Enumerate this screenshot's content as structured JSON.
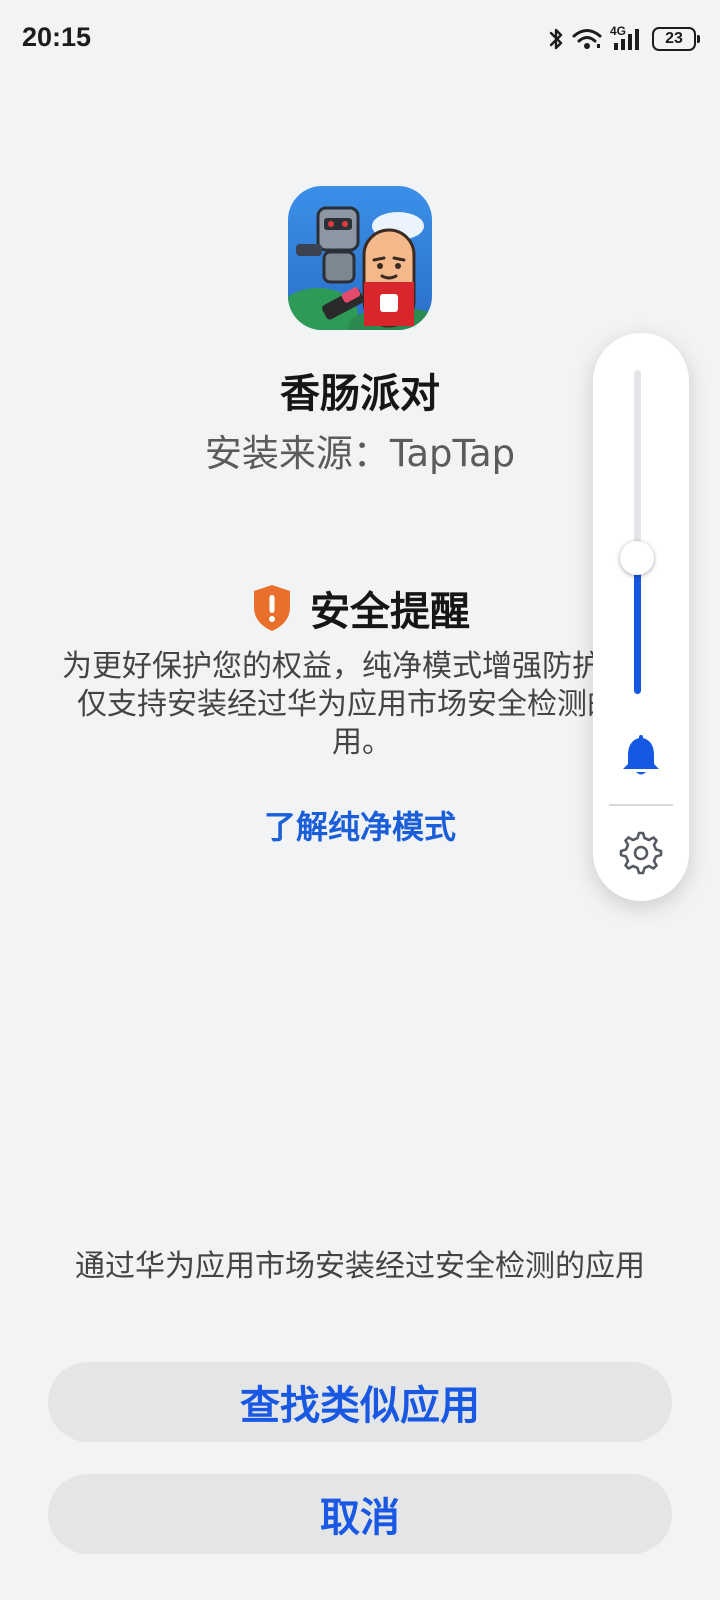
{
  "status_bar": {
    "time": "20:15",
    "network": "4G",
    "battery": "23",
    "icons": [
      "bluetooth-icon",
      "wifi-icon",
      "cellular-signal-icon",
      "battery-icon"
    ]
  },
  "app": {
    "name": "香肠派对",
    "install_source": "安装来源：TapTap",
    "icon": "app-icon-sausage-party"
  },
  "security": {
    "icon": "shield-warning-icon",
    "title": "安全提醒",
    "body": "为更好保护您的权益，纯净模式增强防护下，仅支持安装经过华为应用市场安全检测的应用。",
    "learn_more": "了解纯净模式"
  },
  "volume_panel": {
    "level": 0.42,
    "icons": [
      "bell-icon",
      "gear-icon"
    ]
  },
  "footer": {
    "hint": "通过华为应用市场安装经过安全检测的应用",
    "find_similar_button": "查找类似应用",
    "cancel_button": "取消"
  },
  "colors": {
    "background": "#f1f3f5",
    "accent": "#1858e3",
    "warning": "#e8702a",
    "button_bg": "#e4e5e7"
  }
}
